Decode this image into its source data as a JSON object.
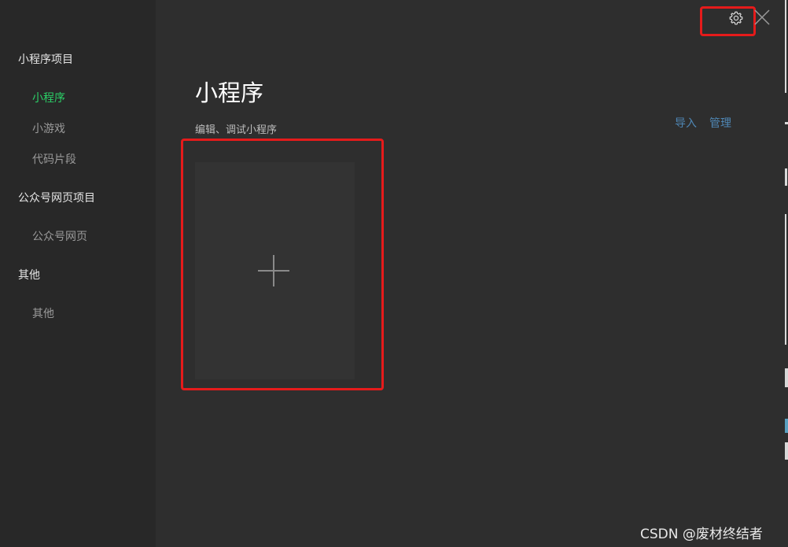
{
  "sidebar": {
    "sections": [
      {
        "title": "小程序项目",
        "items": [
          {
            "label": "小程序",
            "active": true
          },
          {
            "label": "小游戏",
            "active": false
          },
          {
            "label": "代码片段",
            "active": false
          }
        ]
      },
      {
        "title": "公众号网页项目",
        "items": [
          {
            "label": "公众号网页",
            "active": false
          }
        ]
      },
      {
        "title": "其他",
        "items": [
          {
            "label": "其他",
            "active": false
          }
        ]
      }
    ]
  },
  "main": {
    "title": "小程序",
    "subtitle": "编辑、调试小程序",
    "import_label": "导入",
    "manage_label": "管理",
    "add_card_icon": "plus-icon"
  },
  "toolbar": {
    "settings_icon": "gear-icon",
    "close_icon": "close-icon"
  },
  "watermark": "CSDN @废材终结者",
  "colors": {
    "sidebar_bg": "#282828",
    "main_bg": "#2e2e2e",
    "active_green": "#2bd067",
    "link_blue": "#4f87b5",
    "highlight_red": "#e51b1b"
  }
}
